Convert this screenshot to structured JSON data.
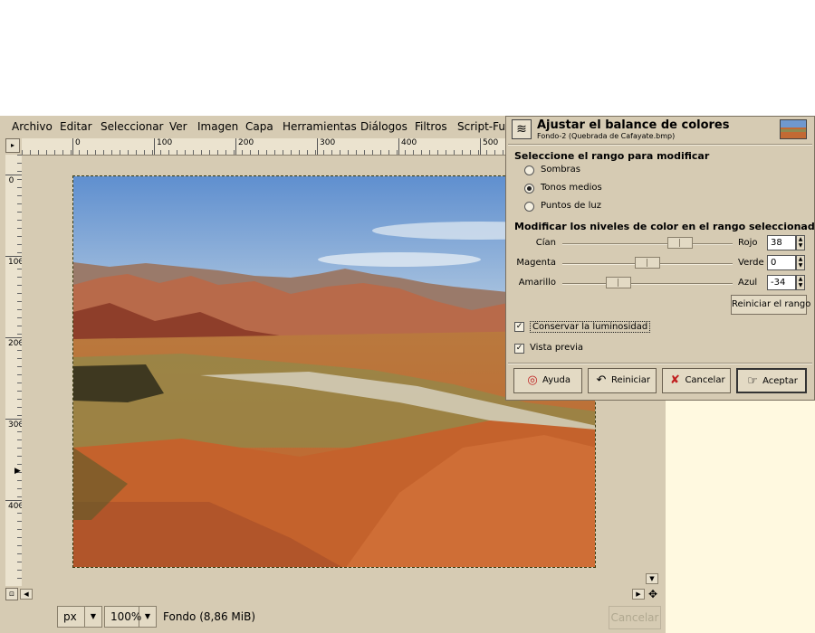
{
  "menubar": {
    "items": [
      {
        "label": "Archivo"
      },
      {
        "label": "Editar"
      },
      {
        "label": "Seleccionar"
      },
      {
        "label": "Ver"
      },
      {
        "label": "Imagen"
      },
      {
        "label": "Capa"
      },
      {
        "label": "Herramientas"
      },
      {
        "label": "Diálogos"
      },
      {
        "label": "Filtros"
      },
      {
        "label": "Script-Fu"
      }
    ]
  },
  "rulers": {
    "horizontal_labels": [
      "0",
      "100",
      "200",
      "300",
      "400",
      "500"
    ],
    "vertical_labels": [
      "0",
      "100",
      "200",
      "300",
      "400"
    ]
  },
  "statusbar": {
    "unit": "px",
    "zoom": "100%",
    "info": "Fondo (8,86 MiB)",
    "cancel_label": "Cancelar"
  },
  "dialog": {
    "title": "Ajustar el balance de colores",
    "subtitle": "Fondo-2 (Quebrada de Cafayate.bmp)",
    "range_section": "Seleccione el rango para modificar",
    "ranges": [
      {
        "label": "Sombras",
        "selected": false
      },
      {
        "label": "Tonos medios",
        "selected": true
      },
      {
        "label": "Puntos de luz",
        "selected": false
      }
    ],
    "levels_section": "Modificar los niveles de color en el rango seleccionado",
    "sliders": [
      {
        "left": "Cían",
        "right": "Rojo",
        "value": "38",
        "level": 38
      },
      {
        "left": "Magenta",
        "right": "Verde",
        "value": "0",
        "level": 0
      },
      {
        "left": "Amarillo",
        "right": "Azul",
        "value": "-34",
        "level": -34
      }
    ],
    "reset_range": "Reiniciar el rango",
    "preserve_luminosity": "Conservar la luminosidad",
    "preview": "Vista previa",
    "buttons": {
      "help": "Ayuda",
      "reset": "Reiniciar",
      "cancel": "Cancelar",
      "ok": "Aceptar"
    }
  }
}
